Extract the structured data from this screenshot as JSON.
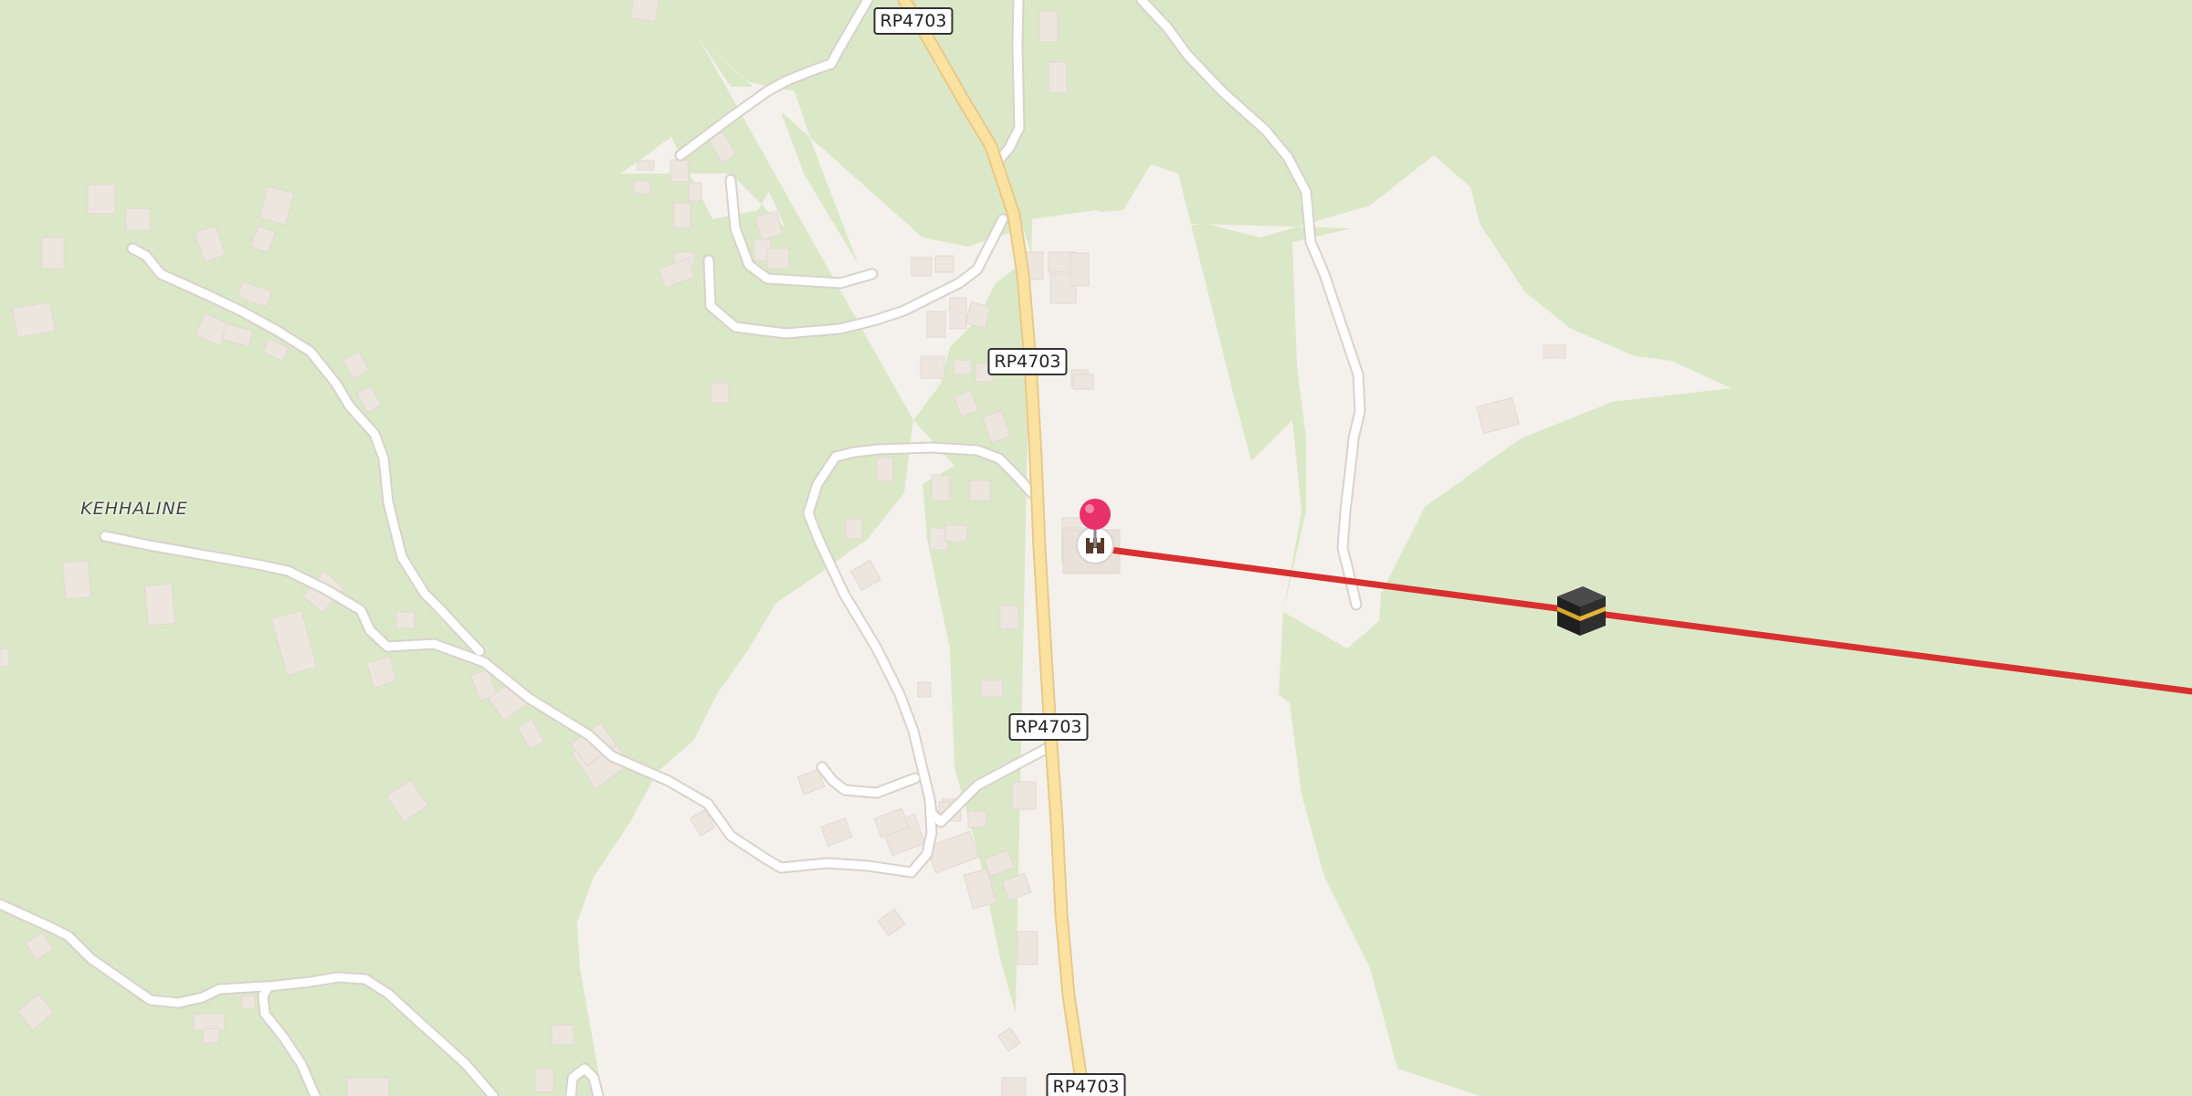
{
  "map": {
    "place_label": "KEHHALINE",
    "road_labels": [
      "RP4703",
      "RP4703",
      "RP4703",
      "RP4703"
    ],
    "pin_icon": "location-pin-icon",
    "poi_icon": "castle-icon",
    "destination_icon": "kaaba-icon",
    "colors": {
      "forest": "#dbe8c7",
      "residential": "#f4f1ec",
      "building": "#ece6df",
      "road_primary": "#fbe2a0",
      "road_minor": "#ffffff",
      "direction_line": "#d83030",
      "pin": "#e8306a"
    }
  }
}
